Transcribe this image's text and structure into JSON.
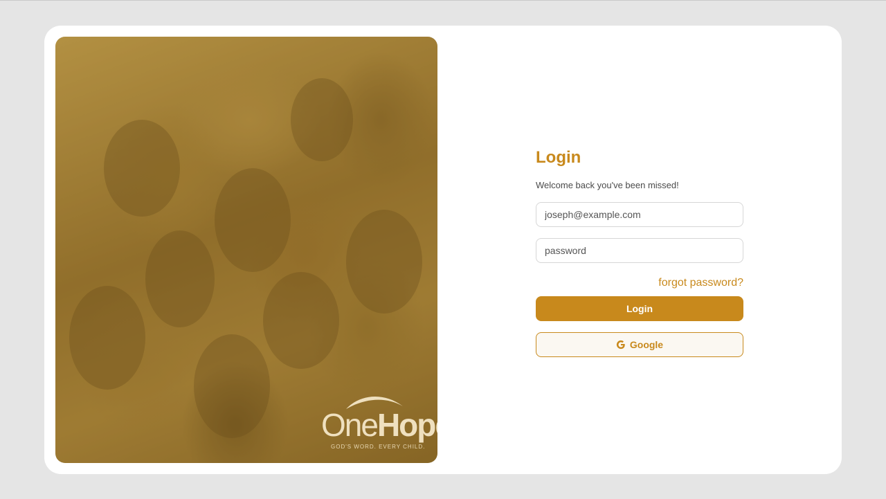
{
  "brand": {
    "logo_word_light": "One",
    "logo_word_bold": "Hope",
    "tagline": "GOD'S WORD. EVERY CHILD."
  },
  "login": {
    "title": "Login",
    "subtitle": "Welcome back you've been missed!",
    "email_placeholder": "joseph@example.com",
    "password_placeholder": "password",
    "forgot_label": "forgot password?",
    "login_button_label": "Login",
    "google_button_label": "Google"
  },
  "colors": {
    "accent": "#c8891c",
    "background": "#e5e5e5",
    "card": "#ffffff"
  },
  "icons": {
    "google": "google-g-icon"
  }
}
